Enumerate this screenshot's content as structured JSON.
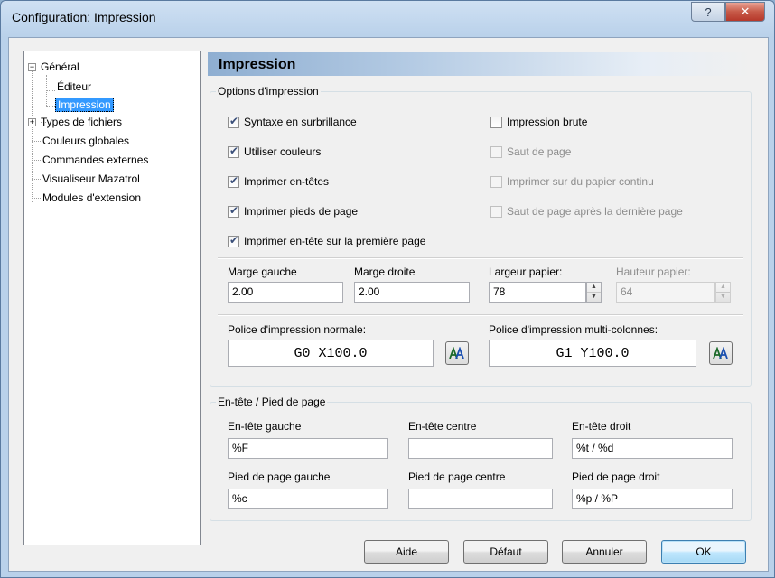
{
  "window": {
    "title": "Configuration: Impression",
    "help_glyph": "?",
    "close_glyph": "✕"
  },
  "tree": {
    "items": [
      {
        "label": "Général",
        "expander": "−"
      },
      {
        "label": "Éditeur"
      },
      {
        "label": "Impression"
      },
      {
        "label": "Types de fichiers",
        "expander": "+"
      },
      {
        "label": "Couleurs globales"
      },
      {
        "label": "Commandes externes"
      },
      {
        "label": "Visualiseur Mazatrol"
      },
      {
        "label": "Modules d'extension"
      }
    ]
  },
  "pane": {
    "title": "Impression"
  },
  "options": {
    "legend": "Options d'impression",
    "syntax": "Syntaxe en surbrillance",
    "colors": "Utiliser couleurs",
    "headers": "Imprimer en-têtes",
    "footers": "Imprimer pieds de page",
    "first_page_header": "Imprimer en-tête sur la première page",
    "raw": "Impression brute",
    "page_break": "Saut de page",
    "continuous": "Imprimer sur du papier continu",
    "last_page_break": "Saut de page après la dernière page",
    "margin_left_label": "Marge gauche",
    "margin_left_value": "2.00",
    "margin_right_label": "Marge droite",
    "margin_right_value": "2.00",
    "paper_width_label": "Largeur papier:",
    "paper_width_value": "78",
    "paper_height_label": "Hauteur papier:",
    "paper_height_value": "64",
    "font_normal_label": "Police d'impression normale:",
    "font_normal_sample": "G0 X100.0",
    "font_multi_label": "Police d'impression multi-colonnes:",
    "font_multi_sample": "G1 Y100.0"
  },
  "hf": {
    "legend": "En-tête / Pied de page",
    "header_left_label": "En-tête gauche",
    "header_left_value": "%F",
    "header_center_label": "En-tête centre",
    "header_center_value": "",
    "header_right_label": "En-tête droit",
    "header_right_value": "%t / %d",
    "footer_left_label": "Pied de page gauche",
    "footer_left_value": "%c",
    "footer_center_label": "Pied de page centre",
    "footer_center_value": "",
    "footer_right_label": "Pied de page droit",
    "footer_right_value": "%p / %P"
  },
  "buttons": {
    "help": "Aide",
    "default": "Défaut",
    "cancel": "Annuler",
    "ok": "OK"
  }
}
